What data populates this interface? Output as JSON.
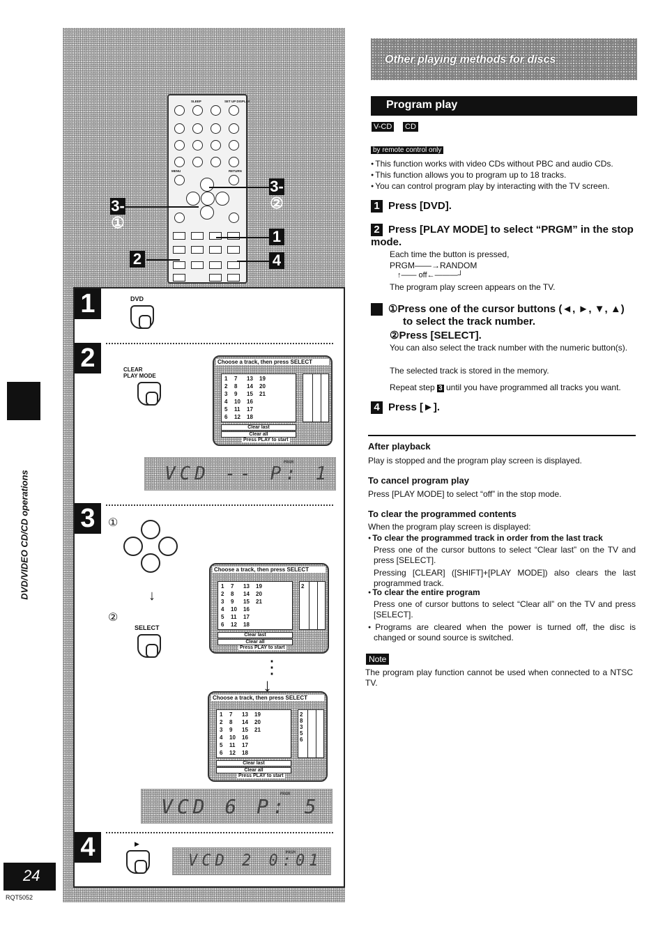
{
  "header": {
    "title": "Other playing methods for discs"
  },
  "section": {
    "title": "Program play"
  },
  "disc_badges": [
    "V-CD",
    "CD"
  ],
  "remote_only": "by remote control only",
  "intro_bullets": [
    "This function works with video CDs without PBC and audio CDs.",
    "This function allows you to program up to 18 tracks.",
    "You can control program play by interacting with the TV screen."
  ],
  "steps": [
    {
      "num": "1",
      "title": "Press [DVD]."
    },
    {
      "num": "2",
      "title": "Press [PLAY MODE] to select “PRGM” in the stop mode.",
      "text1": "Each time the button is pressed,",
      "cycle_a": "PRGM——→RANDOM",
      "cycle_b": "↑—— off←———┘",
      "text2": "The program play screen appears on the TV."
    },
    {
      "num": "3",
      "title1": "①Press one of the cursor buttons (◄, ►, ▼, ▲) to select the track number.",
      "title2": "②Press [SELECT].",
      "text1": "You can also select the track number with the numeric button(s).",
      "text2": "The selected track is stored in the memory.",
      "repeat_a": "Repeat step",
      "repeat_num": "3",
      "repeat_b": "until you have programmed all tracks you want."
    },
    {
      "num": "4",
      "title": "Press [►]."
    }
  ],
  "after_playback": {
    "title": "After playback",
    "text": "Play is stopped and the program play screen is displayed."
  },
  "cancel": {
    "title": "To cancel program play",
    "text": "Press [PLAY MODE] to select “off” in the stop mode."
  },
  "clear": {
    "title": "To clear the programmed contents",
    "intro": "When the program play screen is displayed:",
    "last_title": "To clear the programmed track in order from the last track",
    "last_text1": "Press one of the cursor buttons to select “Clear last” on the TV and press [SELECT].",
    "last_text2": "Pressing [CLEAR] ([SHIFT]+[PLAY MODE]) also clears the last programmed track.",
    "all_title": "To clear the entire program",
    "all_text": "Press one of cursor buttons to select “Clear all” on the TV and press [SELECT].",
    "note_bullet": "Programs are cleared when the power is turned off, the disc is changed or sound source is switched."
  },
  "note": {
    "label": "Note",
    "text": "The program play function cannot be used when connected to a NTSC TV."
  },
  "sidebar": {
    "label": "DVD/VIDEO CD/CD operations",
    "page_number": "24",
    "model": "RQT5052"
  },
  "figure": {
    "callouts": [
      "3-①",
      "3-②",
      "1",
      "2",
      "4"
    ],
    "step1_label": "DVD",
    "step2_label": "CLEAR PLAY MODE",
    "step3_circ1": "①",
    "step3_circ2": "②",
    "step3_label": "SELECT",
    "tv_header": "Choose a track, then press SELECT",
    "tv_tracks": [
      "1",
      "7",
      "13",
      "19",
      "2",
      "8",
      "14",
      "20",
      "3",
      "9",
      "15",
      "21",
      "4",
      "10",
      "16",
      "",
      "5",
      "11",
      "17",
      "",
      "6",
      "12",
      "18",
      ""
    ],
    "tv_clear_last": "Clear last",
    "tv_clear_all": "Clear all",
    "tv_start": "Press PLAY to start",
    "tv_programs": [
      [],
      [
        "2"
      ],
      [
        "2",
        "8",
        "3",
        "5",
        "6"
      ]
    ],
    "lcd_prgm": "PRGM",
    "lcd_displays": [
      "VCD --  P: 1",
      "VCD 6  P: 5",
      "VCD 2  0:01"
    ],
    "remote_labels": [
      "SLEEP",
      "SUB TITLE TITLE",
      "SET UP DISPLAY",
      "DISC",
      "MENU",
      "RETURN",
      "SELECT",
      "MARKER",
      "AV EFFECT ANGLE",
      "DVD",
      "PLAY MODE",
      "AUDIO"
    ]
  }
}
